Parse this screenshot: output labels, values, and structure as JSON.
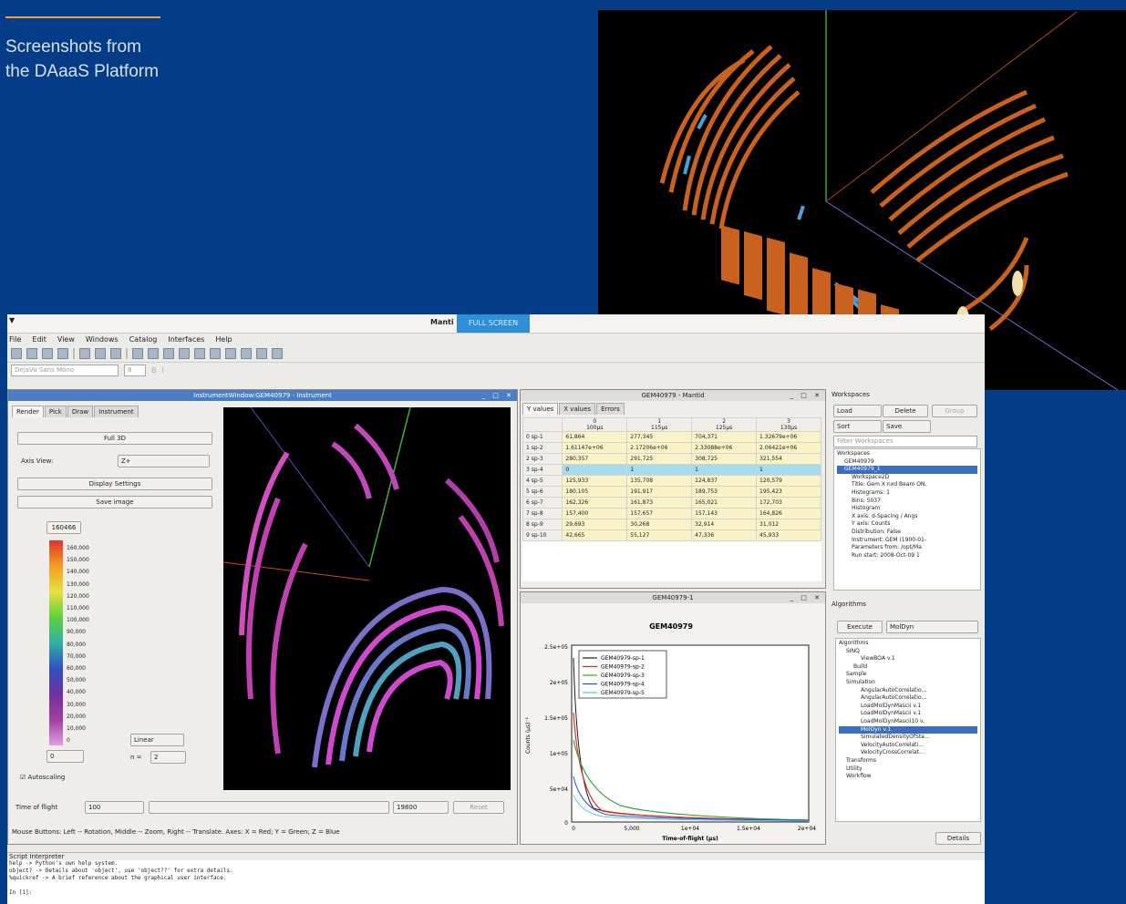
{
  "caption": {
    "line1": "Screenshots from",
    "line2": "the DAaaS Platform"
  },
  "colors": {
    "background": "#043c88",
    "accent_rule": "#e8a33b",
    "detector_orange": "#c8621e",
    "detector_blue": "#4aa0d8"
  },
  "app": {
    "title": "Manti",
    "fullscreen_label": "FULL SCREEN",
    "menu": [
      "File",
      "Edit",
      "View",
      "Windows",
      "Catalog",
      "Interfaces",
      "Help"
    ],
    "font_combo": "DejaVu Sans Mono",
    "font_size": "8"
  },
  "instrument": {
    "title": "InstrumentWindow:GEM40979 - Instrument",
    "tabs": [
      "Render",
      "Pick",
      "Draw",
      "Instrument"
    ],
    "full3d": "Full 3D",
    "axis_label": "Axis View:",
    "axis_value": "Z+",
    "display_settings": "Display Settings",
    "save_image": "Save image",
    "scale_top": "160466",
    "scale_ticks": [
      "160,000",
      "150,000",
      "140,000",
      "130,000",
      "120,000",
      "110,000",
      "100,000",
      "90,000",
      "80,000",
      "70,000",
      "60,000",
      "50,000",
      "40,000",
      "30,000",
      "20,000",
      "10,000",
      "0"
    ],
    "scale_min": "0",
    "scale_type": "Linear",
    "n_label": "n =",
    "n_value": "2",
    "autoscaling": "Autoscaling",
    "tof_label": "Time of flight",
    "tof_min": "100",
    "tof_max": "19800",
    "reset": "Reset",
    "status": "Mouse Buttons: Left -- Rotation, Middle -- Zoom, Right -- Translate. Axes: X = Red; Y = Green; Z = Blue"
  },
  "table": {
    "title": "GEM40979 - Mantid",
    "tabs": [
      "Y values",
      "X values",
      "Errors"
    ],
    "col_index": [
      "0",
      "1",
      "2",
      "3"
    ],
    "col_x": [
      "100µs",
      "115µs",
      "125µs",
      "130µs"
    ],
    "rows": [
      {
        "label": "0 sp-1",
        "v": [
          "61,864",
          "277,345",
          "704,371",
          "1.32679e+06"
        ]
      },
      {
        "label": "1 sp-2",
        "v": [
          "1.61147e+06",
          "2.17206e+06",
          "2.33088e+06",
          "2.06421e+06"
        ]
      },
      {
        "label": "2 sp-3",
        "v": [
          "280,357",
          "291,725",
          "308,725",
          "321,554"
        ]
      },
      {
        "label": "3 sp-4",
        "v": [
          "0",
          "1",
          "1",
          "1"
        ]
      },
      {
        "label": "4 sp-5",
        "v": [
          "125,933",
          "135,708",
          "124,837",
          "120,579"
        ]
      },
      {
        "label": "5 sp-6",
        "v": [
          "180,105",
          "191,917",
          "189,753",
          "195,423"
        ]
      },
      {
        "label": "6 sp-7",
        "v": [
          "162,326",
          "161,873",
          "165,021",
          "172,703"
        ]
      },
      {
        "label": "7 sp-8",
        "v": [
          "157,400",
          "157,657",
          "157,143",
          "164,826"
        ]
      },
      {
        "label": "8 sp-9",
        "v": [
          "29,693",
          "30,268",
          "32,914",
          "31,012"
        ]
      },
      {
        "label": "9 sp-10",
        "v": [
          "42,665",
          "55,127",
          "47,336",
          "45,933"
        ]
      }
    ]
  },
  "plot": {
    "title": "GEM40979-1",
    "chart_title": "GEM40979",
    "ylabel": "Counts (µs)⁻¹",
    "xlabel": "Time-of-flight (µs)",
    "yticks": [
      "2.5e+05",
      "2e+05",
      "1.5e+05",
      "1e+05",
      "5e+04",
      "0"
    ],
    "xticks": [
      "0",
      "5,000",
      "1e+04",
      "1.5e+04",
      "2e+04"
    ],
    "legend": [
      "GEM40979-sp-1",
      "GEM40979-sp-2",
      "GEM40979-sp-3",
      "GEM40979-sp-4",
      "GEM40979-sp-5"
    ],
    "legend_colors": [
      "#1a1a1a",
      "#e03020",
      "#40a040",
      "#3050d0",
      "#60c0e0"
    ]
  },
  "workspaces": {
    "title": "Workspaces",
    "load": "Load",
    "delete": "Delete",
    "group": "Group",
    "sort": "Sort",
    "save": "Save",
    "filter_placeholder": "Filter Workspaces",
    "tree": [
      {
        "t": "Workspaces",
        "l": 0,
        "hi": false
      },
      {
        "t": "GEM40979",
        "l": 1,
        "hi": false
      },
      {
        "t": "GEM40979_1",
        "l": 1,
        "hi": true
      },
      {
        "t": "Workspace2D",
        "l": 2,
        "hi": false
      },
      {
        "t": "Title: Gem X nxd Beam ON,",
        "l": 2,
        "hi": false
      },
      {
        "t": "Histograms: 1",
        "l": 2,
        "hi": false
      },
      {
        "t": "Bins: 5037",
        "l": 2,
        "hi": false
      },
      {
        "t": "Histogram",
        "l": 2,
        "hi": false
      },
      {
        "t": "X axis: d-Spacing / Angs",
        "l": 2,
        "hi": false
      },
      {
        "t": "Y axis: Counts",
        "l": 2,
        "hi": false
      },
      {
        "t": "Distribution: False",
        "l": 2,
        "hi": false
      },
      {
        "t": "Instrument: GEM (1900-01-",
        "l": 2,
        "hi": false
      },
      {
        "t": "Parameters from: /opt/Ma",
        "l": 2,
        "hi": false
      },
      {
        "t": "Run start: 2008-Oct-09 1",
        "l": 2,
        "hi": false
      }
    ]
  },
  "algorithms": {
    "title": "Algorithms",
    "execute": "Execute",
    "current": "MolDyn",
    "tree": [
      {
        "t": "Algorithms",
        "l": 0,
        "hi": false
      },
      {
        "t": "SINQ",
        "l": 1,
        "hi": false
      },
      {
        "t": "ViewBOA v.1",
        "l": 3,
        "hi": false
      },
      {
        "t": "Build",
        "l": 2,
        "hi": false
      },
      {
        "t": "Sample",
        "l": 1,
        "hi": false
      },
      {
        "t": "Simulation",
        "l": 1,
        "hi": false
      },
      {
        "t": "AngularAutoCorrelatio…",
        "l": 3,
        "hi": false
      },
      {
        "t": "AngularAutoCorrelatio…",
        "l": 3,
        "hi": false
      },
      {
        "t": "LoadMolDynMascii v.1",
        "l": 3,
        "hi": false
      },
      {
        "t": "LoadMolDynMascii v.1",
        "l": 3,
        "hi": false
      },
      {
        "t": "LoadMolDynMascii10 v.",
        "l": 3,
        "hi": false
      },
      {
        "t": "MolDyn v.1",
        "l": 3,
        "hi": true
      },
      {
        "t": "SimulatedDensityOfSta…",
        "l": 3,
        "hi": false
      },
      {
        "t": "VelocityAutoCorrelati…",
        "l": 3,
        "hi": false
      },
      {
        "t": "VelocityCrossCorrelat…",
        "l": 3,
        "hi": false
      },
      {
        "t": "Transforms",
        "l": 1,
        "hi": false
      },
      {
        "t": "Utility",
        "l": 1,
        "hi": false
      },
      {
        "t": "Workflow",
        "l": 1,
        "hi": false
      }
    ],
    "details": "Details"
  },
  "script": {
    "title": "Script Interpreter",
    "lines": [
      "help     -> Python's own help system.",
      "object?  -> Details about 'object', use 'object??' for extra details.",
      "%quickref -> A brief reference about the graphical user interface.",
      "",
      "In [1]:"
    ]
  }
}
